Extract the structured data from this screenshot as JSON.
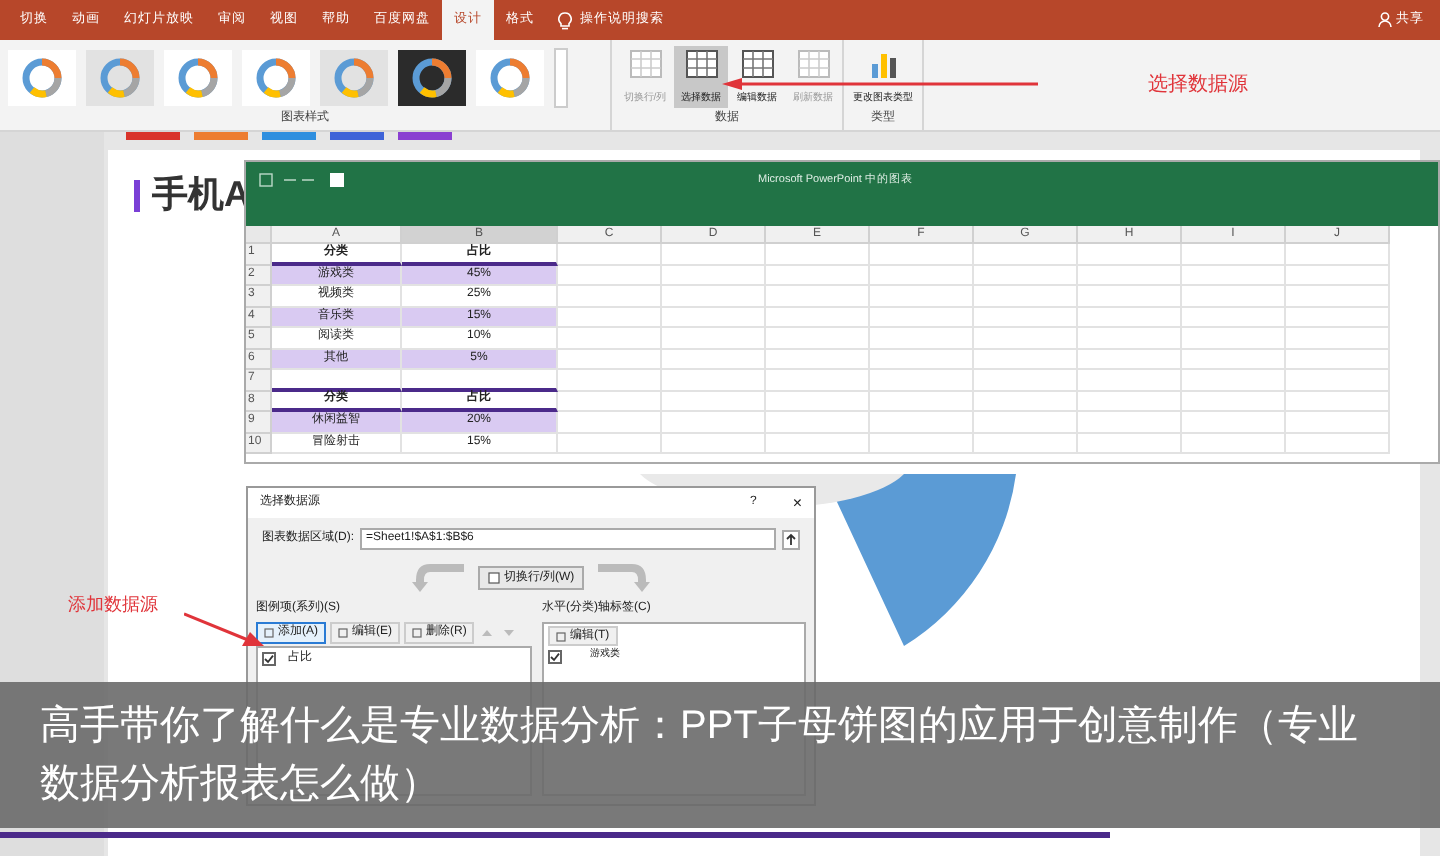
{
  "ribbon": {
    "tabs": [
      {
        "label": "切换",
        "selected": false
      },
      {
        "label": "动画",
        "selected": false
      },
      {
        "label": "幻灯片放映",
        "selected": false
      },
      {
        "label": "审阅",
        "selected": false
      },
      {
        "label": "视图",
        "selected": false
      },
      {
        "label": "帮助",
        "selected": false
      },
      {
        "label": "百度网盘",
        "selected": false
      },
      {
        "label": "设计",
        "selected": true
      },
      {
        "label": "格式",
        "selected": false
      }
    ],
    "search_hint": "操作说明搜索",
    "share": "共享",
    "chart_styles": [
      {
        "kind": "plain"
      },
      {
        "kind": "shaded"
      },
      {
        "kind": "plain"
      },
      {
        "kind": "plain"
      },
      {
        "kind": "shaded"
      },
      {
        "kind": "dark"
      },
      {
        "kind": "plain"
      }
    ],
    "chart_styles_label": "图表样式",
    "data_buttons": [
      {
        "label": "切换行/列",
        "disabled": true,
        "selected": false
      },
      {
        "label": "选择数据",
        "disabled": false,
        "selected": true
      },
      {
        "label": "编辑数据",
        "disabled": false,
        "selected": false
      },
      {
        "label": "刷新数据",
        "disabled": true,
        "selected": false
      }
    ],
    "data_label": "数据",
    "type_button": "更改图表类型",
    "type_label": "类型",
    "swatches": [
      {
        "color": "#d9342b"
      },
      {
        "color": "#ed7d31"
      },
      {
        "color": "#2f8fdf"
      },
      {
        "color": "#3e63d8"
      },
      {
        "color": "#8a3fd1"
      }
    ]
  },
  "annotations": [
    {
      "text": "选择数据源"
    },
    {
      "text": "添加数据源"
    }
  ],
  "slide": {
    "title": "手机A"
  },
  "excel": {
    "title": "Microsoft PowerPoint 中的图表",
    "columns": [
      "A",
      "B",
      "C",
      "D",
      "E",
      "F",
      "G",
      "H",
      "I",
      "J"
    ],
    "rows": [
      {
        "num": "1",
        "kind": "header",
        "cells": [
          "分类",
          "占比"
        ],
        "shaded": false
      },
      {
        "num": "2",
        "kind": "data",
        "cells": [
          "游戏类",
          "45%"
        ],
        "shaded": true
      },
      {
        "num": "3",
        "kind": "data",
        "cells": [
          "视频类",
          "25%"
        ],
        "shaded": false
      },
      {
        "num": "4",
        "kind": "data",
        "cells": [
          "音乐类",
          "15%"
        ],
        "shaded": true
      },
      {
        "num": "5",
        "kind": "data",
        "cells": [
          "阅读类",
          "10%"
        ],
        "shaded": false
      },
      {
        "num": "6",
        "kind": "data",
        "cells": [
          "其他",
          "5%"
        ],
        "shaded": true
      },
      {
        "num": "7",
        "kind": "blank",
        "cells": [],
        "shaded": false
      },
      {
        "num": "8",
        "kind": "header",
        "cells": [
          "分类",
          "占比"
        ],
        "shaded": false
      },
      {
        "num": "9",
        "kind": "data",
        "cells": [
          "休闲益智",
          "20%"
        ],
        "shaded": true
      },
      {
        "num": "10",
        "kind": "data",
        "cells": [
          "冒险射击",
          "15%"
        ],
        "shaded": false
      }
    ]
  },
  "dialog": {
    "title": "选择数据源",
    "help": "?",
    "close": "×",
    "range_label": "图表数据区域(D):",
    "range_value": "=Sheet1!$A$1:$B$6",
    "switch": "切换行/列(W)",
    "series_label": "图例项(系列)(S)",
    "series_buttons": [
      {
        "label": "添加(A)",
        "selected": true
      },
      {
        "label": "编辑(E)",
        "selected": false
      },
      {
        "label": "删除(R)",
        "selected": false
      }
    ],
    "series": [
      {
        "label": "占比",
        "checked": true
      }
    ],
    "axis_label": "水平(分类)轴标签(C)",
    "axis_button": "编辑(T)",
    "axis_items": [
      {
        "label": "游戏类",
        "checked": true
      }
    ]
  },
  "caption": "高手带你了解什么是专业数据分析：PPT子母饼图的应用于创意制作（专业数据分析报表怎么做）"
}
